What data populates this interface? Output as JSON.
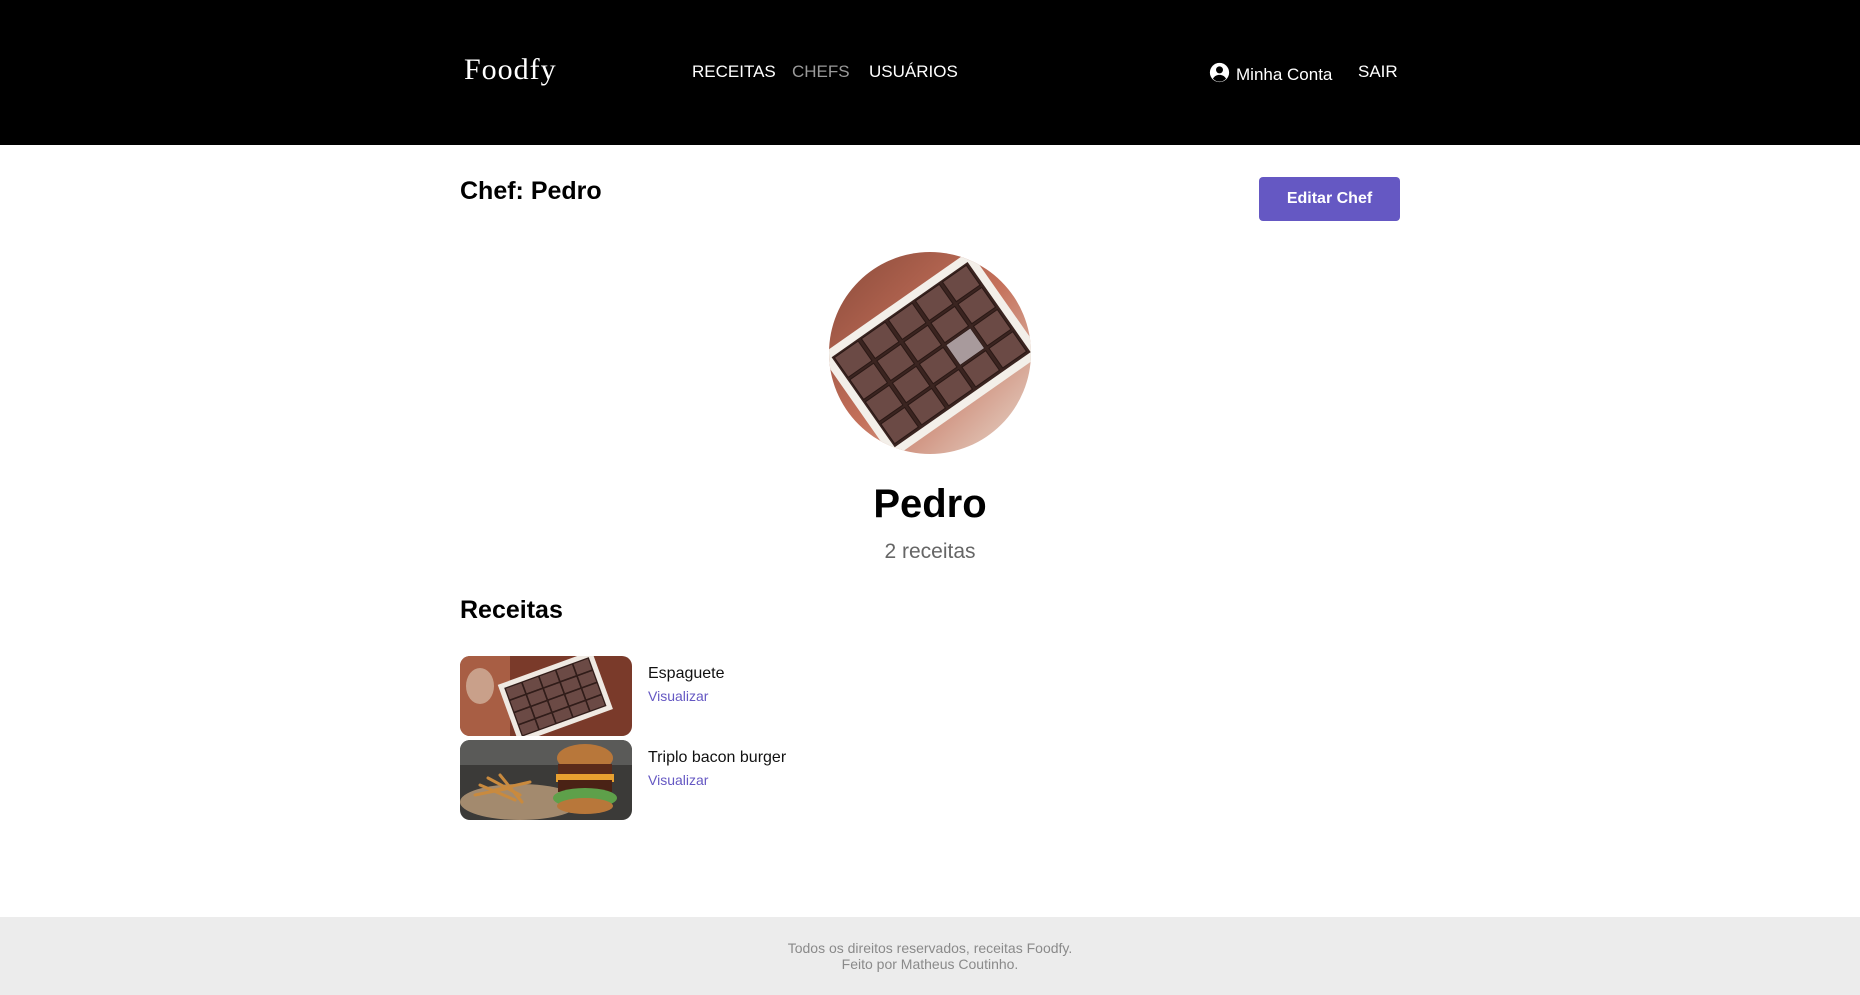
{
  "header": {
    "logo": "Foodfy",
    "nav": [
      {
        "label": "RECEITAS"
      },
      {
        "label": "CHEFS"
      },
      {
        "label": "USUÁRIOS"
      }
    ],
    "account_label": "Minha Conta",
    "account_icon": "user-circle-icon",
    "logout_label": "SAIR"
  },
  "page": {
    "title": "Chef: Pedro",
    "edit_button": "Editar Chef"
  },
  "chef": {
    "name": "Pedro",
    "recipes_count": "2 receitas"
  },
  "recipes_section": {
    "title": "Receitas",
    "items": [
      {
        "title": "Espaguete",
        "link": "Visualizar"
      },
      {
        "title": "Triplo bacon burger",
        "link": "Visualizar"
      }
    ]
  },
  "footer": {
    "line1": "Todos os direitos reservados, receitas Foodfy.",
    "line2": "Feito por Matheus Coutinho."
  },
  "colors": {
    "accent": "#6558c3",
    "header_bg": "#000000",
    "footer_bg": "#ececec"
  }
}
